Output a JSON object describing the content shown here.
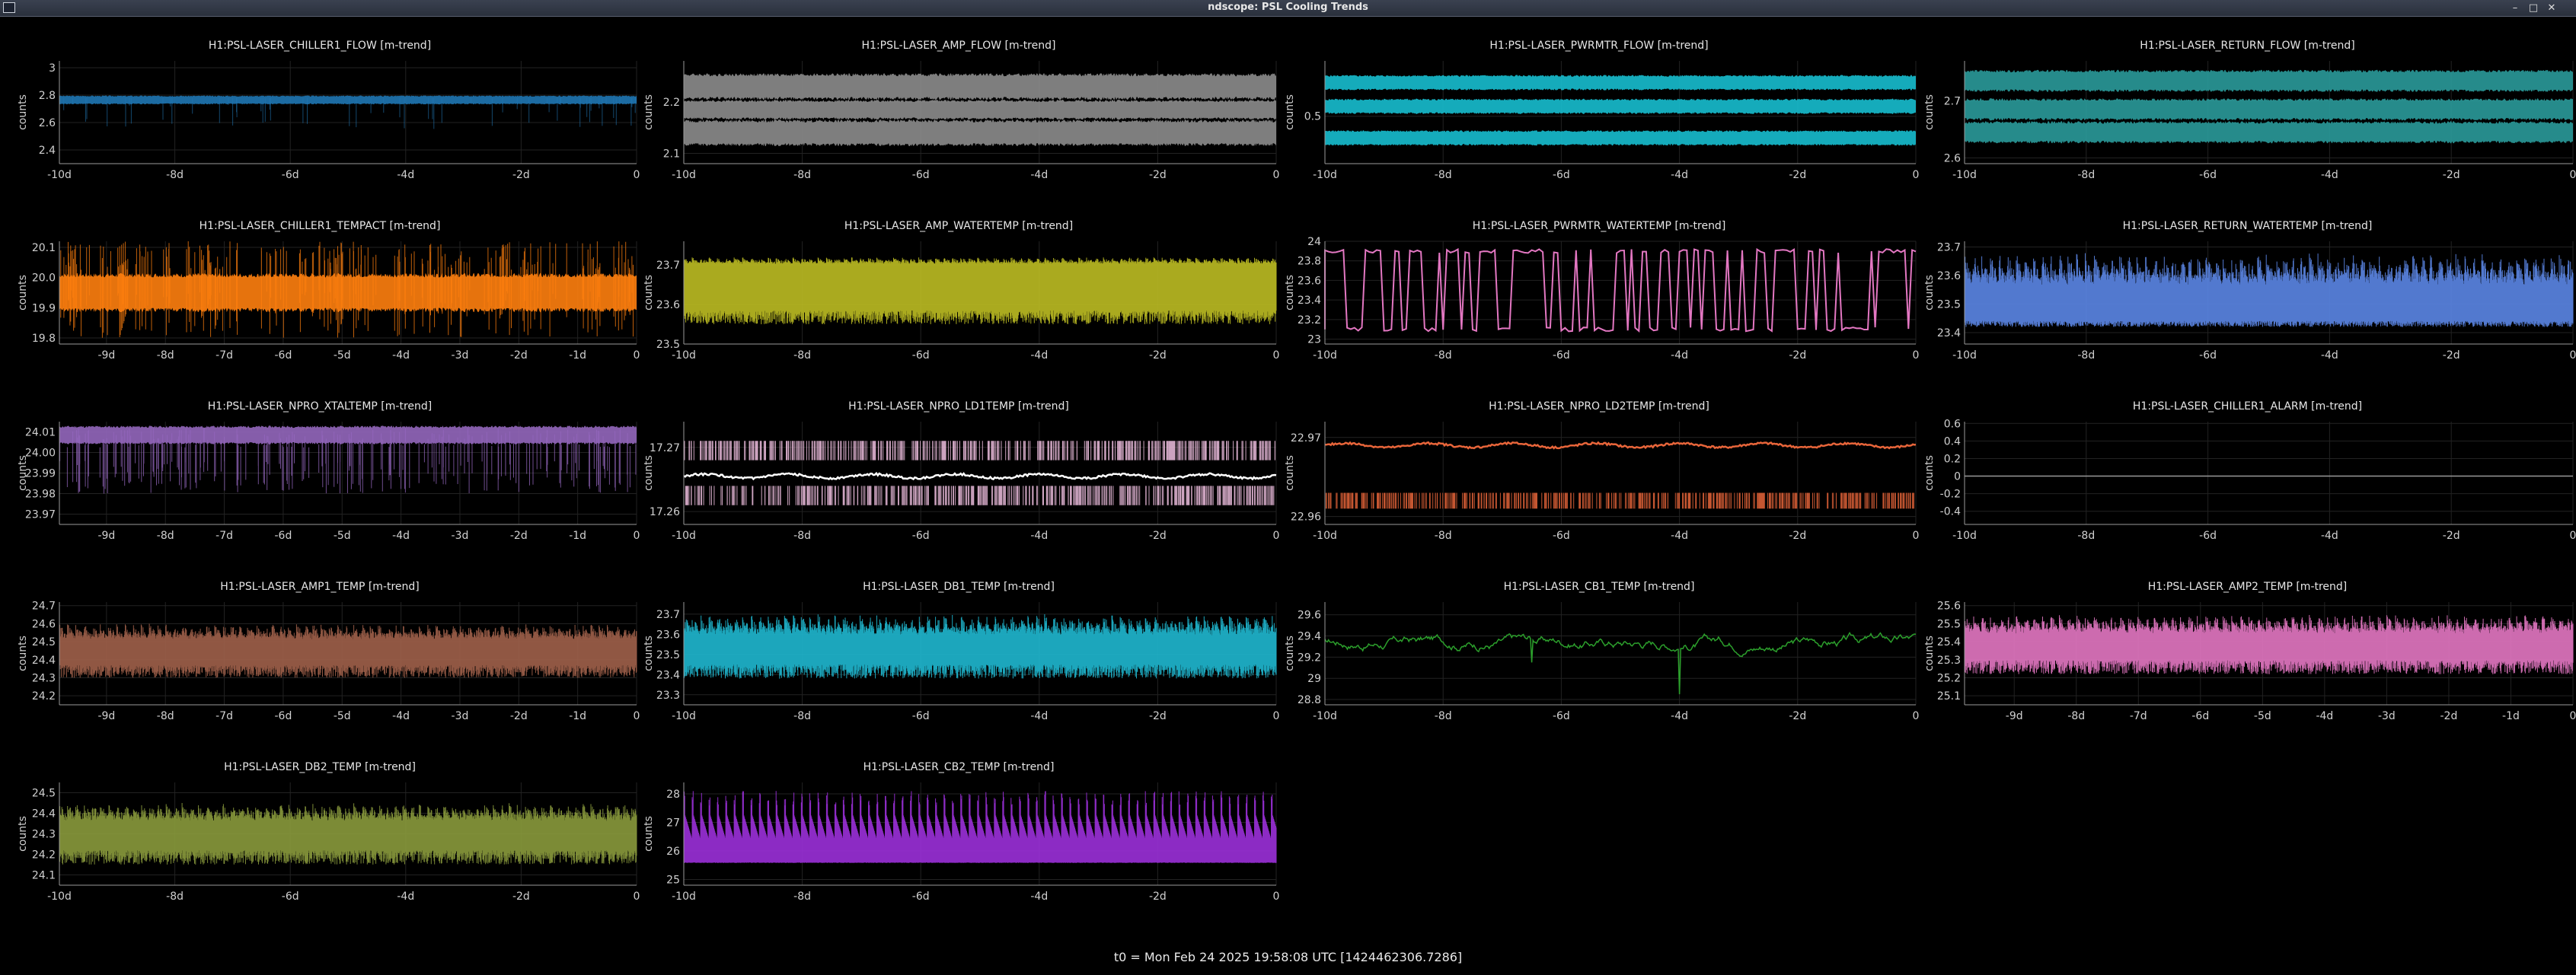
{
  "window": {
    "title": "ndscope: PSL Cooling Trends",
    "controls": {
      "minimize": "–",
      "maximize": "□",
      "close": "✕"
    }
  },
  "footer": {
    "t0": "t0 = Mon Feb 24 2025 19:58:08 UTC [1424462306.7286]"
  },
  "chart_data": [
    {
      "type": "line",
      "title": "H1:PSL-LASER_CHILLER1_FLOW [m-trend]",
      "ylabel": "counts",
      "color": "#1f77b4",
      "style": "flat",
      "xticks": [
        "-10d",
        "-8d",
        "-6d",
        "-4d",
        "-2d",
        "0"
      ],
      "xtick_pos": [
        -10,
        -8,
        -6,
        -4,
        -2,
        0
      ],
      "xlim": [
        -10,
        0
      ],
      "yticks": [
        "2.4",
        "2.6",
        "2.8",
        "3"
      ],
      "ytick_vals": [
        2.4,
        2.6,
        2.8,
        3.0
      ],
      "ylim": [
        2.3,
        3.05
      ],
      "band": [
        [
          2.74,
          2.79
        ]
      ]
    },
    {
      "type": "line",
      "title": "H1:PSL-LASER_AMP_FLOW [m-trend]",
      "ylabel": "counts",
      "color": "#8c8c8c",
      "style": "bands",
      "xticks": [
        "-10d",
        "-8d",
        "-6d",
        "-4d",
        "-2d",
        "0"
      ],
      "xtick_pos": [
        -10,
        -8,
        -6,
        -4,
        -2,
        0
      ],
      "xlim": [
        -10,
        0
      ],
      "yticks": [
        "2.1",
        "2.2"
      ],
      "ytick_vals": [
        2.1,
        2.2
      ],
      "ylim": [
        2.08,
        2.28
      ],
      "band": [
        [
          2.21,
          2.25
        ],
        [
          2.17,
          2.2
        ],
        [
          2.12,
          2.16
        ]
      ]
    },
    {
      "type": "line",
      "title": "H1:PSL-LASER_PWRMTR_FLOW [m-trend]",
      "ylabel": "counts",
      "color": "#17becf",
      "style": "bands",
      "xticks": [
        "-10d",
        "-8d",
        "-6d",
        "-4d",
        "-2d",
        "0"
      ],
      "xtick_pos": [
        -10,
        -8,
        -6,
        -4,
        -2,
        0
      ],
      "xlim": [
        -10,
        0
      ],
      "yticks": [
        "0.5"
      ],
      "ytick_vals": [
        0.5
      ],
      "ylim": [
        0.44,
        0.57
      ],
      "band": [
        [
          0.535,
          0.55
        ],
        [
          0.505,
          0.52
        ],
        [
          0.465,
          0.48
        ]
      ]
    },
    {
      "type": "line",
      "title": "H1:PSL-LASER_RETURN_FLOW [m-trend]",
      "ylabel": "counts",
      "color": "#2a9a9a",
      "style": "bands",
      "xticks": [
        "-10d",
        "-8d",
        "-6d",
        "-4d",
        "-2d",
        "0"
      ],
      "xtick_pos": [
        -10,
        -8,
        -6,
        -4,
        -2,
        0
      ],
      "xlim": [
        -10,
        0
      ],
      "yticks": [
        "2.6",
        "2.7"
      ],
      "ytick_vals": [
        2.6,
        2.7
      ],
      "ylim": [
        2.59,
        2.77
      ],
      "band": [
        [
          2.72,
          2.75
        ],
        [
          2.67,
          2.7
        ],
        [
          2.63,
          2.66
        ]
      ]
    },
    {
      "type": "line",
      "title": "H1:PSL-LASER_CHILLER1_TEMPACT [m-trend]",
      "ylabel": "counts",
      "color": "#ff7f0e",
      "style": "digital",
      "xticks": [
        "-9d",
        "-8d",
        "-7d",
        "-6d",
        "-5d",
        "-4d",
        "-3d",
        "-2d",
        "-1d",
        "0"
      ],
      "xtick_pos": [
        -9,
        -8,
        -7,
        -6,
        -5,
        -4,
        -3,
        -2,
        -1,
        0
      ],
      "xlim": [
        -9.8,
        0
      ],
      "yticks": [
        "19.8",
        "19.9",
        "20.0",
        "20.1"
      ],
      "ytick_vals": [
        19.8,
        19.9,
        20.0,
        20.1
      ],
      "ylim": [
        19.78,
        20.12
      ],
      "band": [
        [
          19.9,
          20.0
        ]
      ],
      "spike": [
        19.8,
        20.12
      ]
    },
    {
      "type": "line",
      "title": "H1:PSL-LASER_AMP_WATERTEMP [m-trend]",
      "ylabel": "counts",
      "color": "#bcbd22",
      "style": "sawtooth",
      "xticks": [
        "-10d",
        "-8d",
        "-6d",
        "-4d",
        "-2d",
        "0"
      ],
      "xtick_pos": [
        -10,
        -8,
        -6,
        -4,
        -2,
        0
      ],
      "xlim": [
        -10,
        0
      ],
      "yticks": [
        "23.5",
        "23.6",
        "23.7"
      ],
      "ytick_vals": [
        23.5,
        23.6,
        23.7
      ],
      "ylim": [
        23.5,
        23.76
      ],
      "band": [
        [
          23.6,
          23.7
        ]
      ],
      "spike": [
        23.55,
        23.72
      ]
    },
    {
      "type": "line",
      "title": "H1:PSL-LASER_PWRMTR_WATERTEMP [m-trend]",
      "ylabel": "counts",
      "color": "#e377c2",
      "style": "square",
      "xticks": [
        "-10d",
        "-8d",
        "-6d",
        "-4d",
        "-2d",
        "0"
      ],
      "xtick_pos": [
        -10,
        -8,
        -6,
        -4,
        -2,
        0
      ],
      "xlim": [
        -10,
        0
      ],
      "yticks": [
        "23",
        "23.2",
        "23.4",
        "23.6",
        "23.8",
        "24"
      ],
      "ytick_vals": [
        23.0,
        23.2,
        23.4,
        23.6,
        23.8,
        24.0
      ],
      "ylim": [
        22.95,
        24.0
      ],
      "band": [
        [
          23.1,
          23.9
        ]
      ]
    },
    {
      "type": "line",
      "title": "H1:PSL-LASER_RETURN_WATERTEMP [m-trend]",
      "ylabel": "counts",
      "color": "#5b86e5",
      "style": "sawtooth",
      "xticks": [
        "-10d",
        "-8d",
        "-6d",
        "-4d",
        "-2d",
        "0"
      ],
      "xtick_pos": [
        -10,
        -8,
        -6,
        -4,
        -2,
        0
      ],
      "xlim": [
        -10,
        0
      ],
      "yticks": [
        "23.4",
        "23.5",
        "23.6",
        "23.7"
      ],
      "ytick_vals": [
        23.4,
        23.5,
        23.6,
        23.7
      ],
      "ylim": [
        23.36,
        23.72
      ],
      "band": [
        [
          23.45,
          23.55
        ]
      ],
      "spike": [
        23.42,
        23.68
      ]
    },
    {
      "type": "line",
      "title": "H1:PSL-LASER_NPRO_XTALTEMP [m-trend]",
      "ylabel": "counts",
      "color": "#9467bd",
      "style": "noisy-top",
      "xticks": [
        "-9d",
        "-8d",
        "-7d",
        "-6d",
        "-5d",
        "-4d",
        "-3d",
        "-2d",
        "-1d",
        "0"
      ],
      "xtick_pos": [
        -9,
        -8,
        -7,
        -6,
        -5,
        -4,
        -3,
        -2,
        -1,
        0
      ],
      "xlim": [
        -9.8,
        0
      ],
      "yticks": [
        "23.97",
        "23.98",
        "23.99",
        "24.00",
        "24.01"
      ],
      "ytick_vals": [
        23.97,
        23.98,
        23.99,
        24.0,
        24.01
      ],
      "ylim": [
        23.965,
        24.015
      ],
      "band": [
        [
          24.005,
          24.012
        ]
      ],
      "spike": [
        23.98,
        24.012
      ]
    },
    {
      "type": "line",
      "title": "H1:PSL-LASER_NPRO_LD1TEMP [m-trend]",
      "ylabel": "counts",
      "color": "#f0c0e0",
      "style": "two-level",
      "xticks": [
        "-10d",
        "-8d",
        "-6d",
        "-4d",
        "-2d",
        "0"
      ],
      "xtick_pos": [
        -10,
        -8,
        -6,
        -4,
        -2,
        0
      ],
      "xlim": [
        -10,
        0
      ],
      "yticks": [
        "17.26",
        "17.27"
      ],
      "ytick_vals": [
        17.26,
        17.27
      ],
      "ylim": [
        17.258,
        17.274
      ],
      "band": [
        [
          17.268,
          17.271
        ],
        [
          17.261,
          17.264
        ]
      ],
      "center": 17.2655
    },
    {
      "type": "line",
      "title": "H1:PSL-LASER_NPRO_LD2TEMP [m-trend]",
      "ylabel": "counts",
      "color": "#e8653a",
      "style": "two-level",
      "xticks": [
        "-10d",
        "-8d",
        "-6d",
        "-4d",
        "-2d",
        "0"
      ],
      "xtick_pos": [
        -10,
        -8,
        -6,
        -4,
        -2,
        0
      ],
      "xlim": [
        -10,
        0
      ],
      "yticks": [
        "22.96",
        "22.97"
      ],
      "ytick_vals": [
        22.96,
        22.97
      ],
      "ylim": [
        22.959,
        22.972
      ],
      "band": [
        [
          22.961,
          22.963
        ]
      ],
      "center": 22.969
    },
    {
      "type": "line",
      "title": "H1:PSL-LASER_CHILLER1_ALARM [m-trend]",
      "ylabel": "counts",
      "color": "#9a9a9a",
      "style": "zero",
      "xticks": [
        "-10d",
        "-8d",
        "-6d",
        "-4d",
        "-2d",
        "0"
      ],
      "xtick_pos": [
        -10,
        -8,
        -6,
        -4,
        -2,
        0
      ],
      "xlim": [
        -10,
        0
      ],
      "yticks": [
        "-0.4",
        "-0.2",
        "0",
        "0.2",
        "0.4",
        "0.6"
      ],
      "ytick_vals": [
        -0.4,
        -0.2,
        0,
        0.2,
        0.4,
        0.6
      ],
      "ylim": [
        -0.55,
        0.62
      ],
      "center": 0
    },
    {
      "type": "line",
      "title": "H1:PSL-LASER_AMP1_TEMP [m-trend]",
      "ylabel": "counts",
      "color": "#a0604a",
      "style": "sawtooth",
      "xticks": [
        "-9d",
        "-8d",
        "-7d",
        "-6d",
        "-5d",
        "-4d",
        "-3d",
        "-2d",
        "-1d",
        "0"
      ],
      "xtick_pos": [
        -9,
        -8,
        -7,
        -6,
        -5,
        -4,
        -3,
        -2,
        -1,
        0
      ],
      "xlim": [
        -9.8,
        0
      ],
      "yticks": [
        "24.2",
        "24.3",
        "24.4",
        "24.5",
        "24.6",
        "24.7"
      ],
      "ytick_vals": [
        24.2,
        24.3,
        24.4,
        24.5,
        24.6,
        24.7
      ],
      "ylim": [
        24.15,
        24.72
      ],
      "band": [
        [
          24.4,
          24.5
        ]
      ],
      "spike": [
        24.3,
        24.6
      ]
    },
    {
      "type": "line",
      "title": "H1:PSL-LASER_DB1_TEMP [m-trend]",
      "ylabel": "counts",
      "color": "#1fb8d0",
      "style": "sawtooth",
      "xticks": [
        "-10d",
        "-8d",
        "-6d",
        "-4d",
        "-2d",
        "0"
      ],
      "xtick_pos": [
        -10,
        -8,
        -6,
        -4,
        -2,
        0
      ],
      "xlim": [
        -10,
        0
      ],
      "yticks": [
        "23.3",
        "23.4",
        "23.5",
        "23.6",
        "23.7"
      ],
      "ytick_vals": [
        23.3,
        23.4,
        23.5,
        23.6,
        23.7
      ],
      "ylim": [
        23.25,
        23.76
      ],
      "band": [
        [
          23.48,
          23.58
        ]
      ],
      "spike": [
        23.38,
        23.7
      ]
    },
    {
      "type": "line",
      "title": "H1:PSL-LASER_CB1_TEMP [m-trend]",
      "ylabel": "counts",
      "color": "#2ca02c",
      "style": "wander",
      "xticks": [
        "-10d",
        "-8d",
        "-6d",
        "-4d",
        "-2d",
        "0"
      ],
      "xtick_pos": [
        -10,
        -8,
        -6,
        -4,
        -2,
        0
      ],
      "xlim": [
        -10,
        0
      ],
      "yticks": [
        "28.8",
        "29",
        "29.2",
        "29.4",
        "29.6"
      ],
      "ytick_vals": [
        28.8,
        29.0,
        29.2,
        29.4,
        29.6
      ],
      "ylim": [
        28.75,
        29.72
      ],
      "center": 29.35
    },
    {
      "type": "line",
      "title": "H1:PSL-LASER_AMP2_TEMP [m-trend]",
      "ylabel": "counts",
      "color": "#e377c2",
      "style": "sawtooth",
      "xticks": [
        "-9d",
        "-8d",
        "-7d",
        "-6d",
        "-5d",
        "-4d",
        "-3d",
        "-2d",
        "-1d",
        "0"
      ],
      "xtick_pos": [
        -9,
        -8,
        -7,
        -6,
        -5,
        -4,
        -3,
        -2,
        -1,
        0
      ],
      "xlim": [
        -9.8,
        0
      ],
      "yticks": [
        "25.1",
        "25.2",
        "25.3",
        "25.4",
        "25.5",
        "25.6"
      ],
      "ytick_vals": [
        25.1,
        25.2,
        25.3,
        25.4,
        25.5,
        25.6
      ],
      "ylim": [
        25.05,
        25.62
      ],
      "band": [
        [
          25.33,
          25.43
        ]
      ],
      "spike": [
        25.22,
        25.55
      ]
    },
    {
      "type": "line",
      "title": "H1:PSL-LASER_DB2_TEMP [m-trend]",
      "ylabel": "counts",
      "color": "#8a9a3c",
      "style": "sawtooth",
      "xticks": [
        "-10d",
        "-8d",
        "-6d",
        "-4d",
        "-2d",
        "0"
      ],
      "xtick_pos": [
        -10,
        -8,
        -6,
        -4,
        -2,
        0
      ],
      "xlim": [
        -10,
        0
      ],
      "yticks": [
        "24.1",
        "24.2",
        "24.3",
        "24.4",
        "24.5"
      ],
      "ytick_vals": [
        24.1,
        24.2,
        24.3,
        24.4,
        24.5
      ],
      "ylim": [
        24.05,
        24.55
      ],
      "band": [
        [
          24.25,
          24.35
        ]
      ],
      "spike": [
        24.15,
        24.45
      ]
    },
    {
      "type": "line",
      "title": "H1:PSL-LASER_CB2_TEMP [m-trend]",
      "ylabel": "counts",
      "color": "#9b30d9",
      "style": "spikes",
      "xticks": [
        "-10d",
        "-8d",
        "-6d",
        "-4d",
        "-2d",
        "0"
      ],
      "xtick_pos": [
        -10,
        -8,
        -6,
        -4,
        -2,
        0
      ],
      "xlim": [
        -10,
        0
      ],
      "yticks": [
        "25",
        "26",
        "27",
        "28"
      ],
      "ytick_vals": [
        25,
        26,
        27,
        28
      ],
      "ylim": [
        24.8,
        28.4
      ],
      "band": [
        [
          25.6,
          26.4
        ]
      ],
      "spike": [
        25.5,
        28.1
      ]
    }
  ]
}
